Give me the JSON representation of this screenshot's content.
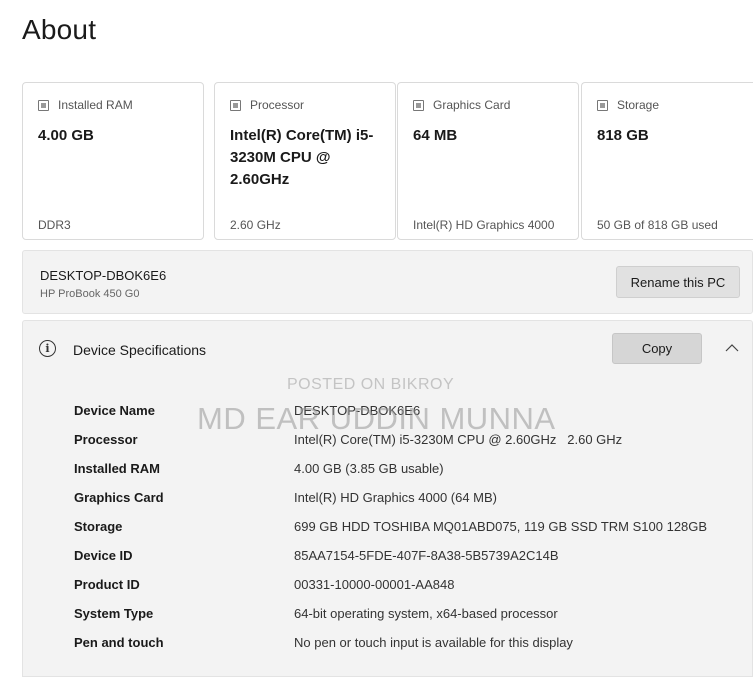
{
  "page": {
    "title": "About"
  },
  "cards": [
    {
      "label": "Installed RAM",
      "icon": "memory-icon",
      "value": "4.00 GB",
      "footer": "DDR3"
    },
    {
      "label": "Processor",
      "icon": "processor-icon",
      "value": "Intel(R) Core(TM) i5-3230M CPU @ 2.60GHz",
      "footer": "2.60 GHz"
    },
    {
      "label": "Graphics Card",
      "icon": "graphics-card-icon",
      "value": "64 MB",
      "footer": "Intel(R) HD Graphics 4000"
    },
    {
      "label": "Storage",
      "icon": "storage-icon",
      "value": "818 GB",
      "footer": "50 GB of 818 GB used"
    }
  ],
  "pc": {
    "name": "DESKTOP-DBOK6E6",
    "model": "HP ProBook 450 G0",
    "rename_label": "Rename this PC"
  },
  "specs": {
    "title": "Device Specifications",
    "copy_label": "Copy",
    "rows": [
      {
        "label": "Device Name",
        "value": "DESKTOP-DBOK6E6"
      },
      {
        "label": "Processor",
        "value": "Intel(R) Core(TM) i5-3230M CPU @ 2.60GHz   2.60 GHz"
      },
      {
        "label": "Installed RAM",
        "value": "4.00 GB (3.85 GB usable)"
      },
      {
        "label": "Graphics Card",
        "value": "Intel(R) HD Graphics 4000 (64 MB)"
      },
      {
        "label": "Storage",
        "value": "699 GB HDD TOSHIBA MQ01ABD075, 119 GB SSD TRM S100 128GB"
      },
      {
        "label": "Device ID",
        "value": "85AA7154-5FDE-407F-8A38-5B5739A2C14B"
      },
      {
        "label": "Product ID",
        "value": "00331-10000-00001-AA848"
      },
      {
        "label": "System Type",
        "value": "64-bit operating system, x64-based processor"
      },
      {
        "label": "Pen and touch",
        "value": "No pen or touch input is available for this display"
      }
    ]
  },
  "watermark": {
    "line1": "POSTED ON BIKROY",
    "line2": "MD EAR UDDIN MUNNA"
  }
}
